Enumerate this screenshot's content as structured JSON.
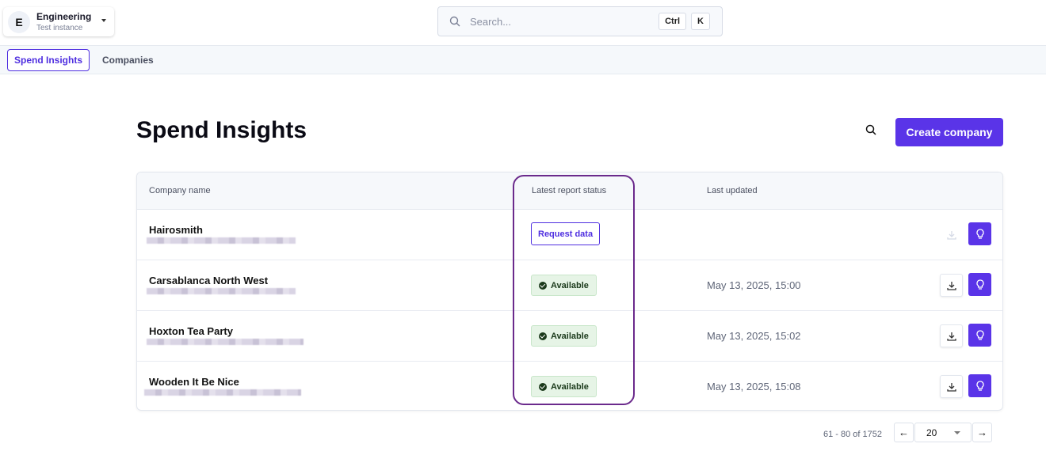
{
  "org": {
    "initial": "E",
    "name": "Engineering",
    "subtitle": "Test instance"
  },
  "search": {
    "placeholder": "Search...",
    "shortcut": [
      "Ctrl",
      "K"
    ]
  },
  "nav": {
    "tabs": [
      {
        "label": "Spend Insights",
        "active": true
      },
      {
        "label": "Companies",
        "active": false
      }
    ]
  },
  "page": {
    "title": "Spend Insights",
    "create_label": "Create company"
  },
  "table": {
    "headers": [
      "Company name",
      "Latest report status",
      "Last updated"
    ],
    "rows": [
      {
        "name": "Hairosmith",
        "status": "Request data",
        "updated": ""
      },
      {
        "name": "Carsablanca North West",
        "status": "Available",
        "updated": "May 13, 2025, 15:00"
      },
      {
        "name": "Hoxton Tea Party",
        "status": "Available",
        "updated": "May 13, 2025, 15:02"
      },
      {
        "name": "Wooden It Be Nice",
        "status": "Available",
        "updated": "May 13, 2025, 15:08"
      }
    ]
  },
  "pagination": {
    "range": "61 - 80 of 1752",
    "page_size": "20"
  },
  "colors": {
    "accent": "#5a34e8",
    "highlight": "#6b2a8c",
    "available_bg": "#e6f4e6"
  }
}
